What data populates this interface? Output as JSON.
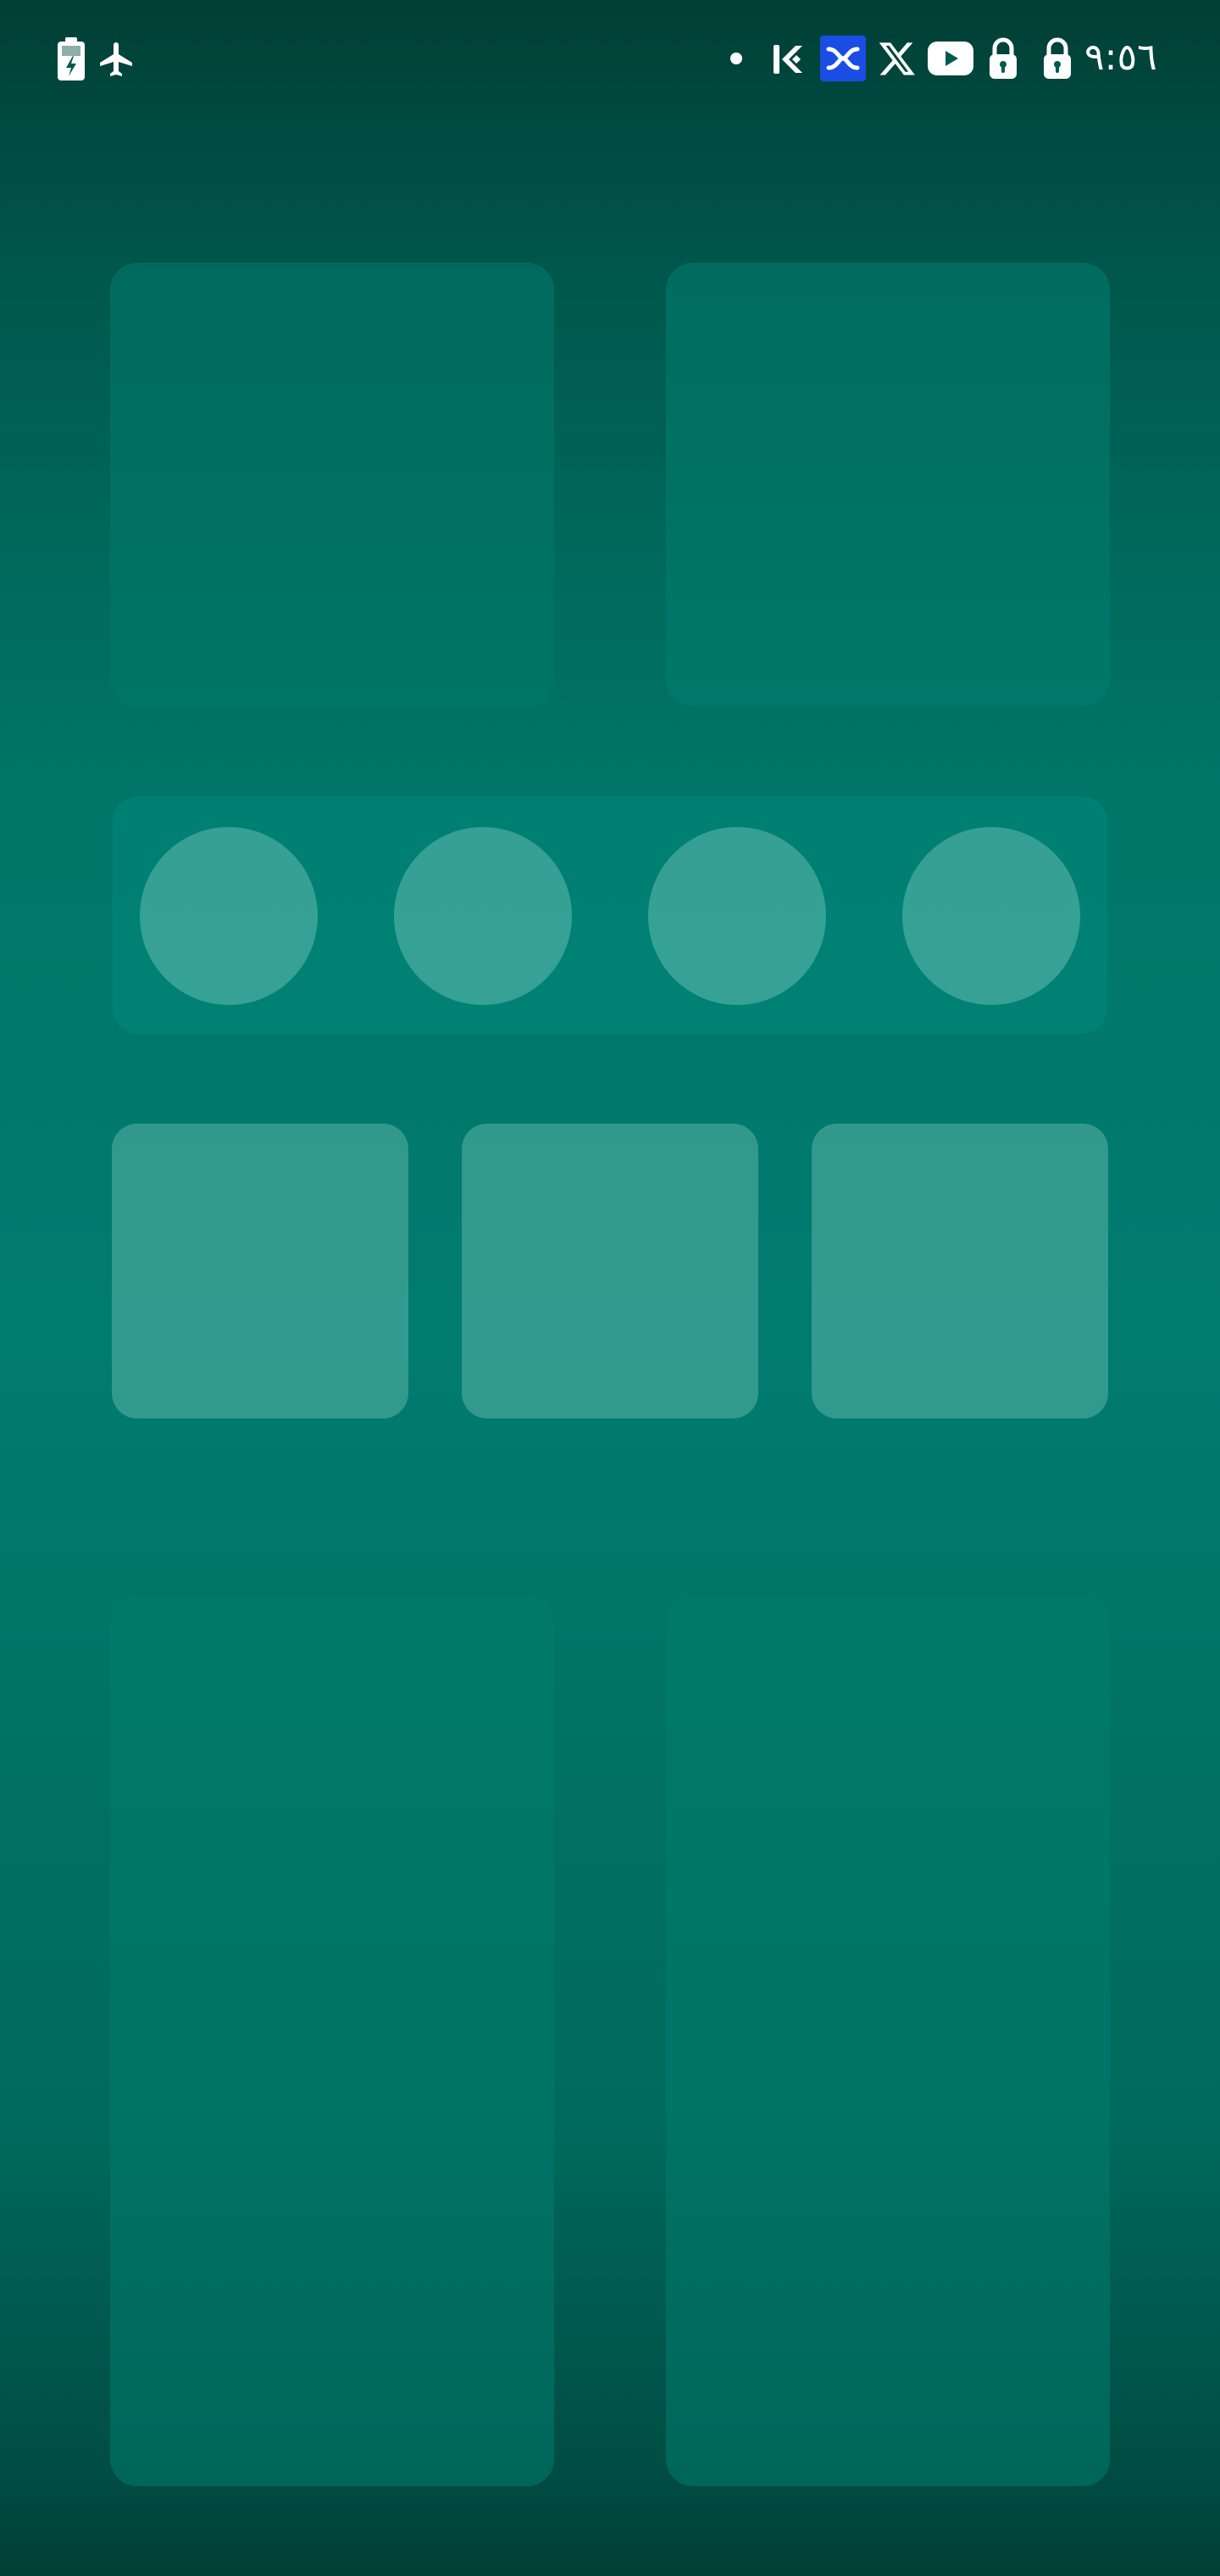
{
  "status_bar": {
    "time": "٩:٥٦",
    "left_icons": [
      "battery-saver-icon",
      "airplane-mode-icon"
    ],
    "right_icons": [
      "notification-dot-icon",
      "kucoin-app-icon",
      "blue-app-icon",
      "x-app-icon",
      "youtube-app-icon",
      "lock-icon",
      "lock-icon"
    ]
  },
  "colors": {
    "background_top": "#003f36",
    "background_mid": "#007c6f",
    "placeholder_light": "#5fb2a8",
    "accent_blue": "#1a4de6",
    "icon_white": "#ffffff"
  },
  "home_screen": {
    "top_widgets": [
      "widget-placeholder",
      "widget-placeholder"
    ],
    "dock_apps": [
      "app-placeholder",
      "app-placeholder",
      "app-placeholder",
      "app-placeholder"
    ],
    "middle_tiles": [
      "tile-placeholder",
      "tile-placeholder",
      "tile-placeholder"
    ],
    "bottom_widgets": [
      "widget-placeholder",
      "widget-placeholder"
    ]
  }
}
